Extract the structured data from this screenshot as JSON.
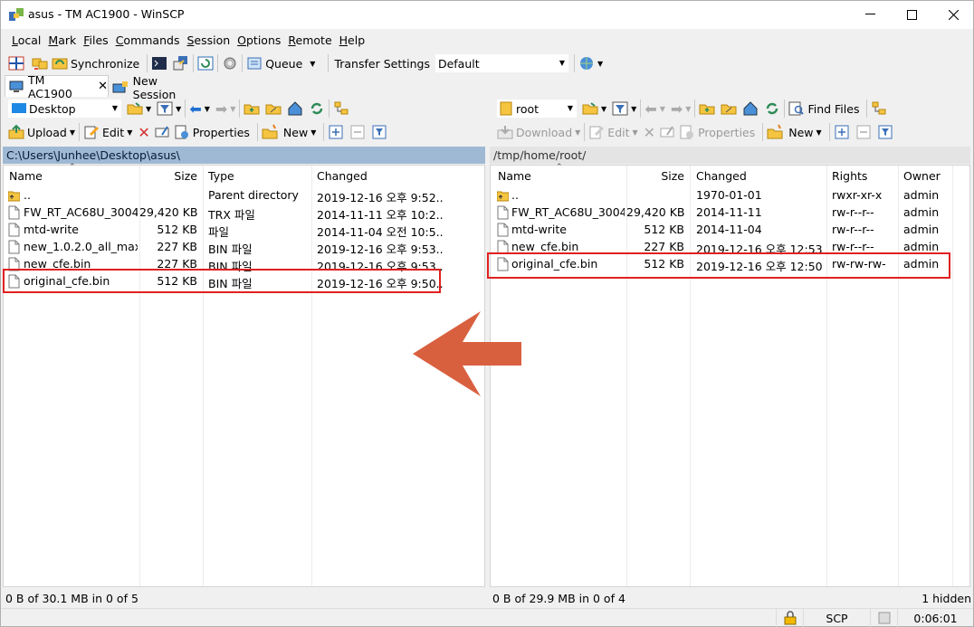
{
  "window": {
    "title": "asus - TM AC1900 - WinSCP"
  },
  "menu": [
    "Local",
    "Mark",
    "Files",
    "Commands",
    "Session",
    "Options",
    "Remote",
    "Help"
  ],
  "toolbar": {
    "synchronize": "Synchronize",
    "queue": "Queue",
    "transfer_settings_label": "Transfer Settings",
    "transfer_settings_value": "Default"
  },
  "tabs": {
    "session": "TM AC1900",
    "new_session": "New Session"
  },
  "left": {
    "location": "Desktop",
    "upload": "Upload",
    "edit": "Edit",
    "properties": "Properties",
    "new": "New",
    "path": "C:\\Users\\Junhee\\Desktop\\asus\\",
    "columns": [
      "Name",
      "Size",
      "Type",
      "Changed"
    ],
    "rows": [
      {
        "name": "..",
        "size": "",
        "type": "Parent directory",
        "changed": "2019-12-16  오후 9:52...",
        "kind": "up"
      },
      {
        "name": "FW_RT_AC68U_3004...",
        "size": "29,420 KB",
        "type": "TRX 파일",
        "changed": "2014-11-11  오후 10:2...",
        "kind": "file"
      },
      {
        "name": "mtd-write",
        "size": "512 KB",
        "type": "파일",
        "changed": "2014-11-04  오전 10:5...",
        "kind": "file"
      },
      {
        "name": "new_1.0.2.0_all_max_...",
        "size": "227 KB",
        "type": "BIN 파일",
        "changed": "2019-12-16  오후 9:53...",
        "kind": "file"
      },
      {
        "name": "new_cfe.bin",
        "size": "227 KB",
        "type": "BIN 파일",
        "changed": "2019-12-16  오후 9:53...",
        "kind": "file"
      },
      {
        "name": "original_cfe.bin",
        "size": "512 KB",
        "type": "BIN 파일",
        "changed": "2019-12-16  오후 9:50...",
        "kind": "file"
      }
    ],
    "status": "0 B of 30.1 MB in 0 of 5"
  },
  "right": {
    "location": "root",
    "download": "Download",
    "edit": "Edit",
    "properties": "Properties",
    "new": "New",
    "find_files": "Find Files",
    "path": "/tmp/home/root/",
    "columns": [
      "Name",
      "Size",
      "Changed",
      "Rights",
      "Owner"
    ],
    "rows": [
      {
        "name": "..",
        "size": "",
        "changed": "1970-01-01",
        "rights": "rwxr-xr-x",
        "owner": "admin",
        "kind": "up"
      },
      {
        "name": "FW_RT_AC68U_3004...",
        "size": "29,420 KB",
        "changed": "2014-11-11",
        "rights": "rw-r--r--",
        "owner": "admin",
        "kind": "file"
      },
      {
        "name": "mtd-write",
        "size": "512 KB",
        "changed": "2014-11-04",
        "rights": "rw-r--r--",
        "owner": "admin",
        "kind": "file"
      },
      {
        "name": "new_cfe.bin",
        "size": "227 KB",
        "changed": "2019-12-16  오후 12:53",
        "rights": "rw-r--r--",
        "owner": "admin",
        "kind": "file"
      },
      {
        "name": "original_cfe.bin",
        "size": "512 KB",
        "changed": "2019-12-16  오후 12:50",
        "rights": "rw-rw-rw-",
        "owner": "admin",
        "kind": "file"
      }
    ],
    "status": "0 B of 29.9 MB in 0 of 4",
    "hidden": "1 hidden"
  },
  "bottom": {
    "protocol": "SCP",
    "elapsed": "0:06:01"
  },
  "colors": {
    "accent_arrow": "#d9603f",
    "highlight_box": "#e02020",
    "path_active": "#9fb9d4"
  }
}
